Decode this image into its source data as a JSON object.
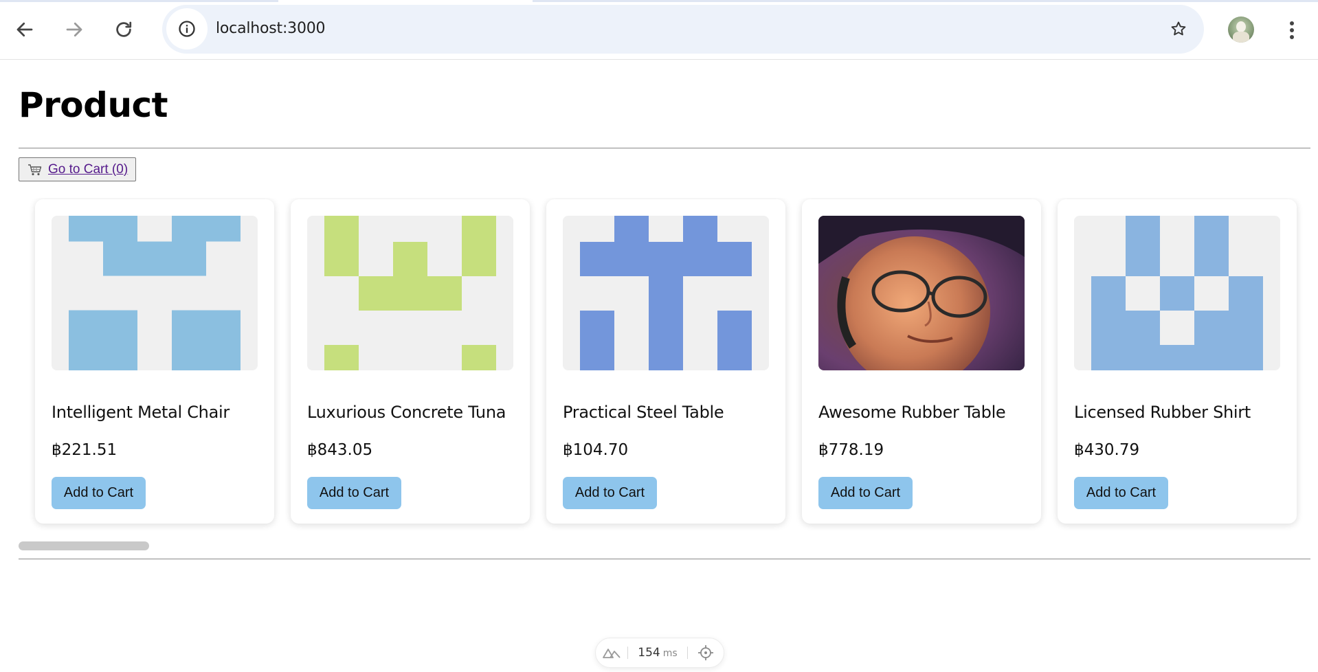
{
  "browser": {
    "url": "localhost:3000",
    "icons": {
      "back": "arrow-left-icon",
      "forward": "arrow-right-icon",
      "reload": "reload-icon",
      "site_info": "info-icon",
      "bookmark": "star-icon",
      "profile": "avatar",
      "menu": "kebab-menu-icon"
    }
  },
  "page": {
    "title": "Product",
    "cart_button": {
      "icon": "shopping-cart-icon",
      "label": "Go to Cart (0)"
    }
  },
  "products": [
    {
      "name": "Intelligent Metal Chair",
      "price": "฿221.51",
      "button": "Add to Cart",
      "image": "identicon",
      "color": "#8bbfe0"
    },
    {
      "name": "Luxurious Concrete Tuna",
      "price": "฿843.05",
      "button": "Add to Cart",
      "image": "identicon",
      "color": "#c6df7d"
    },
    {
      "name": "Practical Steel Table",
      "price": "฿104.70",
      "button": "Add to Cart",
      "image": "identicon",
      "color": "#7396db"
    },
    {
      "name": "Awesome Rubber Table",
      "price": "฿778.19",
      "button": "Add to Cart",
      "image": "photo-of-man-with-glasses",
      "color": "#5a3a6a"
    },
    {
      "name": "Licensed Rubber Shirt",
      "price": "฿430.79",
      "button": "Add to Cart",
      "image": "identicon",
      "color": "#8ab4e0"
    }
  ],
  "devtools": {
    "render_time": "154",
    "unit": "ms",
    "icons": [
      "nuxt-logo-icon",
      "crosshair-icon"
    ]
  },
  "colors": {
    "add_button": "#8ec5ec",
    "link": "#551a8b",
    "omnibox": "#edf2fa",
    "identicon_background": "#f0f0f0"
  }
}
